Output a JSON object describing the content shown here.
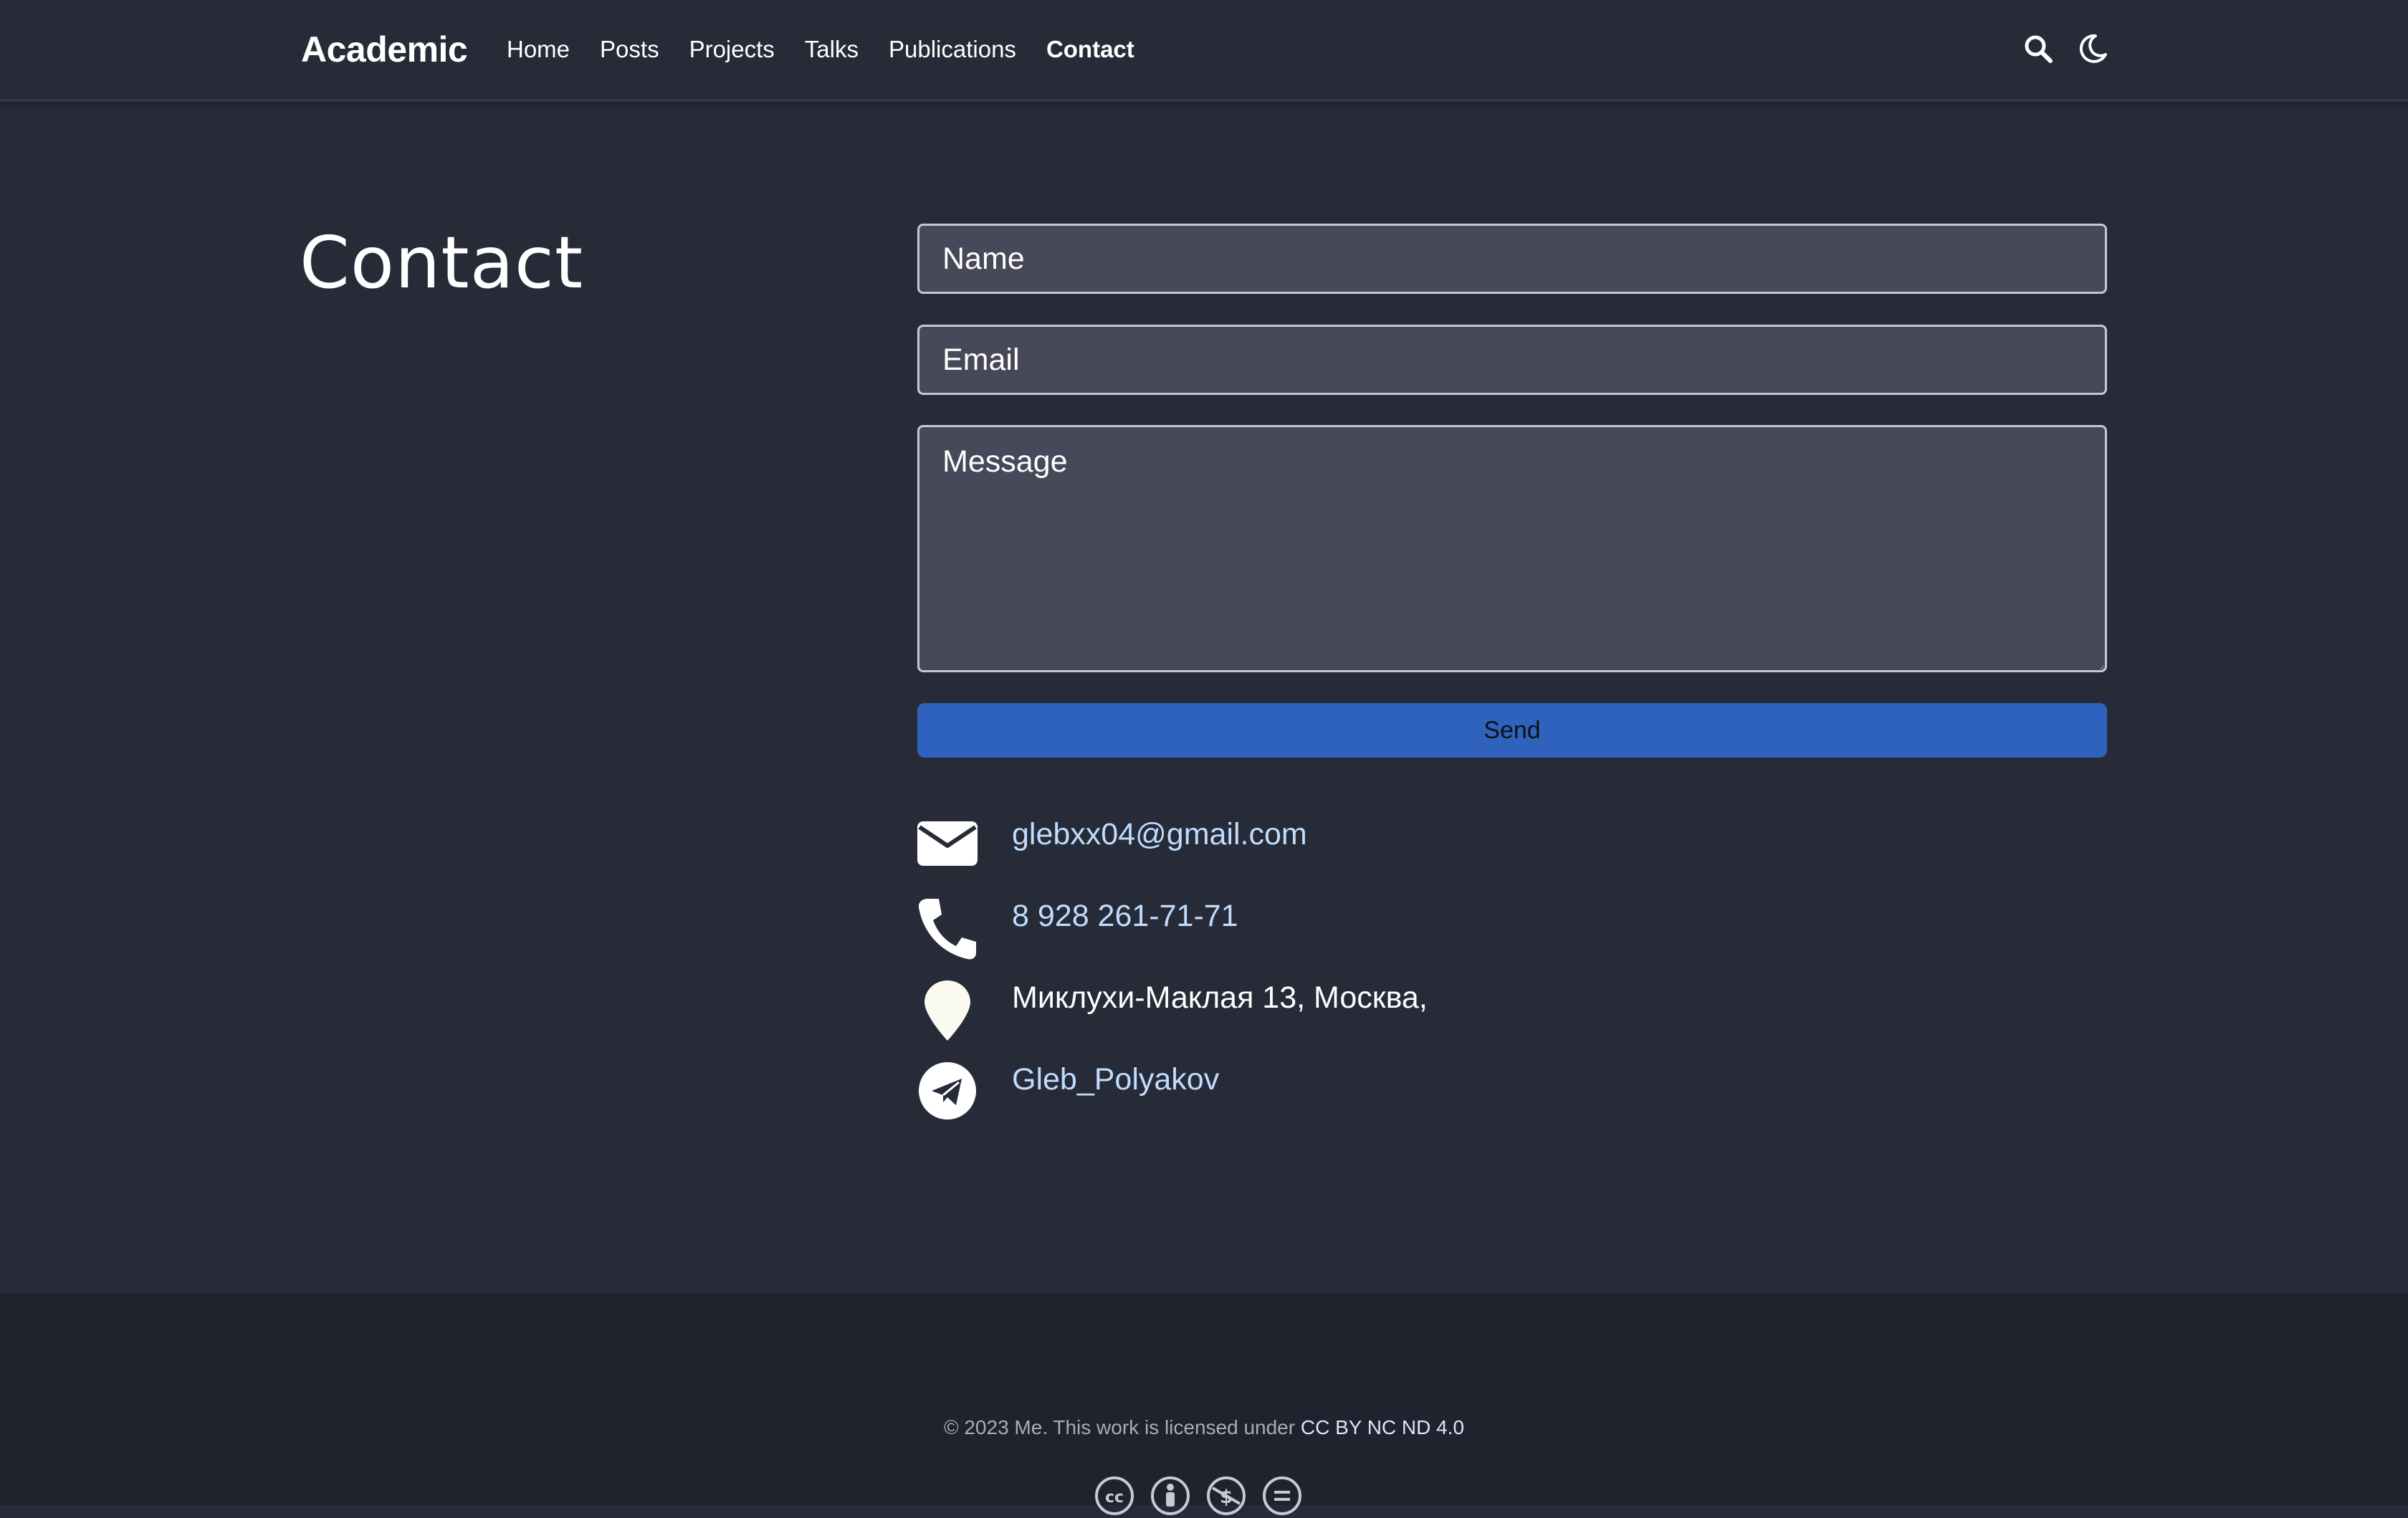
{
  "navbar": {
    "brand": "Academic",
    "links": [
      {
        "label": "Home"
      },
      {
        "label": "Posts"
      },
      {
        "label": "Projects"
      },
      {
        "label": "Talks"
      },
      {
        "label": "Publications"
      },
      {
        "label": "Contact",
        "active": true
      }
    ],
    "icons": [
      "search-icon",
      "moon-icon"
    ]
  },
  "main": {
    "title": "Contact",
    "form": {
      "name_placeholder": "Name",
      "email_placeholder": "Email",
      "message_placeholder": "Message",
      "send_label": "Send"
    },
    "contacts": {
      "email": "glebxx04@gmail.com",
      "phone": "8 928 261-71-71",
      "address": "Миклухи-Маклая 13, Москва,",
      "telegram": "Gleb_Polyakov"
    }
  },
  "footer": {
    "text_prefix": "© 2023 Me. This work is licensed under ",
    "license_link": "CC BY NC ND 4.0",
    "license_icons": [
      "cc-icon",
      "by-icon",
      "nc-icon",
      "nd-icon"
    ]
  },
  "colors": {
    "background": "#272a37",
    "footer_background": "#20222d",
    "input_background": "#474859",
    "button": "#2e62bd",
    "link": "#bfdcff"
  }
}
